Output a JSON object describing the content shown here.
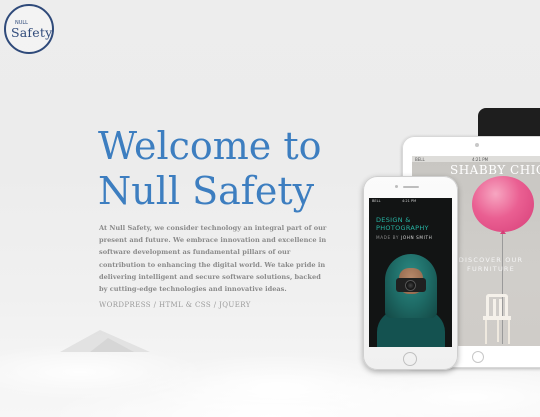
{
  "logo": {
    "small_text": "NULL",
    "main_text": "Safety"
  },
  "hero": {
    "title": "Welcome to Null Safety",
    "description": "At Null Safety, we consider technology an integral part of our present and future. We embrace innovation and excellence in software development as fundamental pillars of our contribution to enhancing the digital world. We take pride in delivering intelligent and secure software solutions, backed by cutting-edge technologies and innovative ideas.",
    "tech_list": "WORDPRESS / HTML & CSS / JQUERY"
  },
  "devices": {
    "tablet": {
      "status_carrier": "BELL",
      "status_time": "4:21 PM",
      "brand": "SHABBY CHIC",
      "tagline": "DISCOVER OUR FURNITURE",
      "balloon_color": "#e94f8a"
    },
    "phone": {
      "status_carrier": "BELL",
      "status_time": "4:21 PM",
      "heading": "DESIGN & PHOTOGRAPHY",
      "byline_prefix": "MADE BY",
      "byline_name": "JOHN SMITH",
      "accent_color": "#27b5a5"
    }
  },
  "colors": {
    "title": "#3d7ec0",
    "logo": "#2f4a7a",
    "body_text": "#8a8a8a"
  }
}
